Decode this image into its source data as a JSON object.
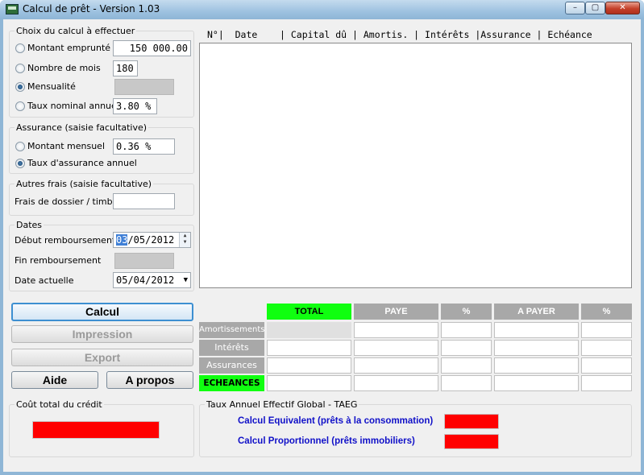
{
  "window": {
    "title": "Calcul de prêt - Version 1.03",
    "min": "–",
    "max": "▢",
    "close": "✕"
  },
  "calc_choice": {
    "legend": "Choix du calcul à effectuer",
    "montant_label": "Montant emprunté",
    "montant_value": "150 000.00",
    "mois_label": "Nombre de mois",
    "mois_value": "180",
    "mensualite_label": "Mensualité",
    "taux_label": "Taux nominal annuel",
    "taux_value": "3.80 %",
    "selected": "Mensualité"
  },
  "assurance": {
    "legend": "Assurance (saisie facultative)",
    "mensuel_label": "Montant mensuel",
    "mensuel_value": "0.36 %",
    "annuel_label": "Taux d'assurance annuel",
    "selected": "Taux d'assurance annuel"
  },
  "frais": {
    "legend": "Autres frais (saisie facultative)",
    "dossier_label": "Frais de dossier / timbre",
    "dossier_value": ""
  },
  "dates": {
    "legend": "Dates",
    "debut_label": "Début remboursement",
    "debut_day": "03",
    "debut_rest": "/05/2012",
    "fin_label": "Fin remboursement",
    "actuelle_label": "Date actuelle",
    "actuelle_value": "05/04/2012"
  },
  "buttons": {
    "calcul": "Calcul",
    "impression": "Impression",
    "export": "Export",
    "aide": "Aide",
    "apropos": "A propos"
  },
  "schedule_header": "N°|  Date    | Capital dû | Amortis. | Intérêts |Assurance | Echéance",
  "summary": {
    "columns": [
      "TOTAL",
      "PAYE",
      "%",
      "A PAYER",
      "%"
    ],
    "rows": [
      "Amortissements",
      "Intérêts",
      "Assurances",
      "ECHEANCES"
    ]
  },
  "cout": {
    "legend": "Coût total du crédit"
  },
  "taeg": {
    "legend": "Taux Annuel Effectif Global - TAEG",
    "equivalent": "Calcul Equivalent (prêts à la consommation)",
    "proportionnel": "Calcul Proportionnel (prêts immobiliers)"
  },
  "colors": {
    "accent_green": "#10ff10",
    "result_red": "#ff0000",
    "label_blue": "#1010c8",
    "header_gray": "#a8a8a8"
  }
}
